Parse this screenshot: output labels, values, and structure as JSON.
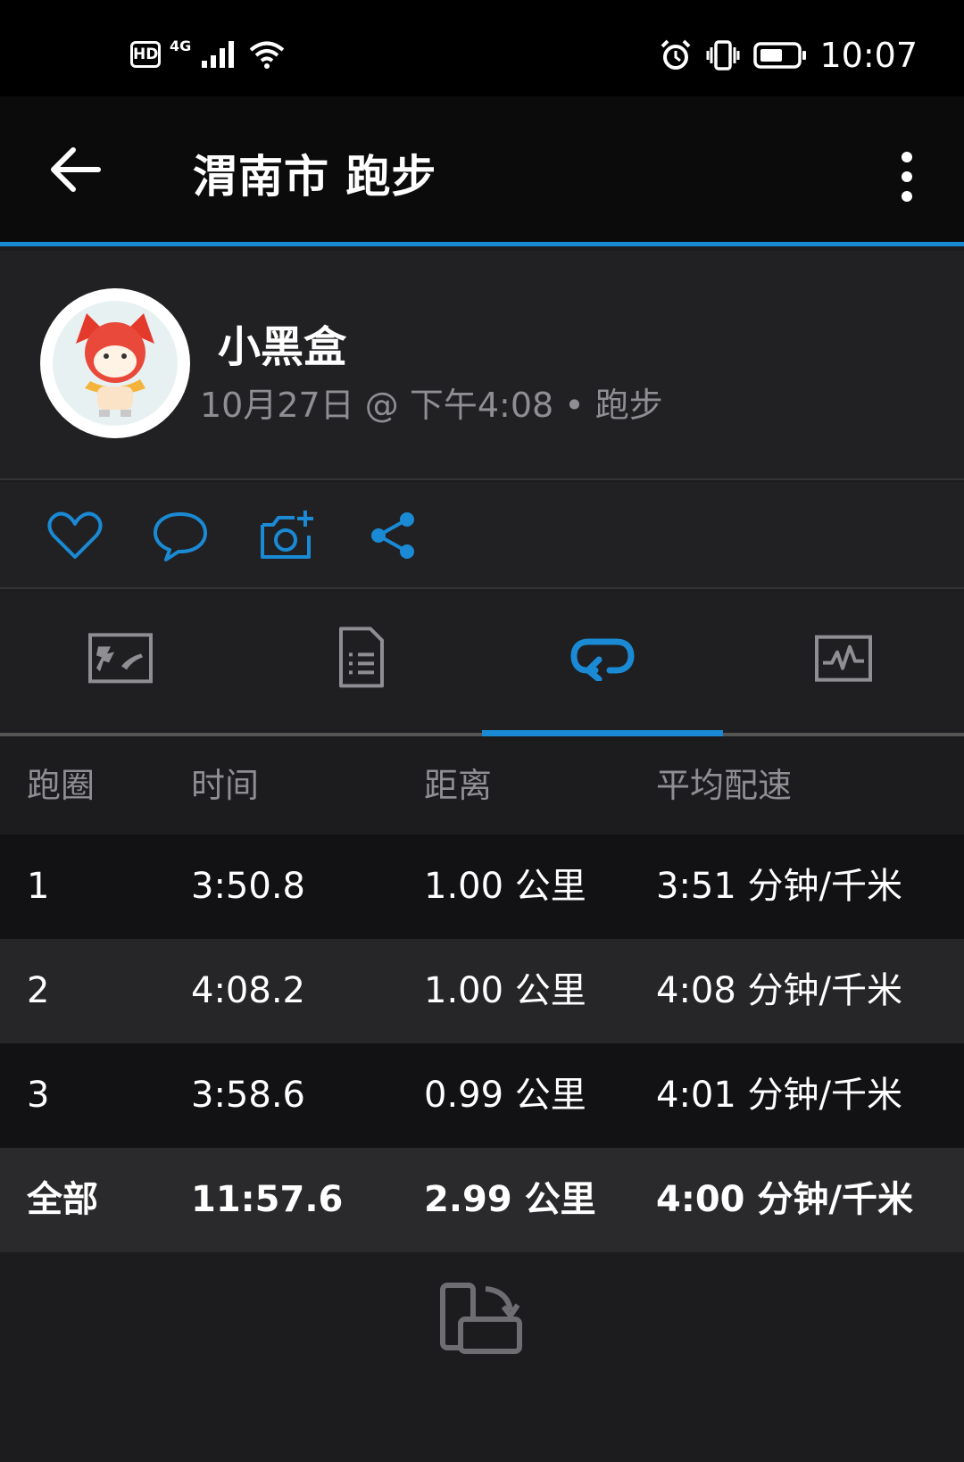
{
  "status_bar": {
    "badge": "HD",
    "network": "4G",
    "time": "10:07",
    "icons": [
      "hd-icon",
      "signal-icon",
      "wifi-icon",
      "alarm-icon",
      "vibrate-icon",
      "battery-icon"
    ]
  },
  "header": {
    "title": "渭南市 跑步",
    "back_icon": "arrow-left-icon",
    "menu_icon": "more-vertical-icon"
  },
  "profile": {
    "name": "小黑盒",
    "meta": "10月27日 @ 下午4:08 • 跑步"
  },
  "actions": [
    {
      "icon": "heart-icon"
    },
    {
      "icon": "comment-icon"
    },
    {
      "icon": "add-photo-icon"
    },
    {
      "icon": "share-icon"
    }
  ],
  "tabs": [
    {
      "icon": "map-icon",
      "active": false
    },
    {
      "icon": "summary-icon",
      "active": false
    },
    {
      "icon": "laps-icon",
      "active": true
    },
    {
      "icon": "chart-icon",
      "active": false
    }
  ],
  "laps_table": {
    "headers": [
      "跑圈",
      "时间",
      "距离",
      "平均配速"
    ],
    "rows": [
      [
        "1",
        "3:50.8",
        "1.00 公里",
        "3:51 分钟/千米"
      ],
      [
        "2",
        "4:08.2",
        "1.00 公里",
        "4:08 分钟/千米"
      ],
      [
        "3",
        "3:58.6",
        "0.99 公里",
        "4:01 分钟/千米"
      ]
    ],
    "total": [
      "全部",
      "11:57.6",
      "2.99 公里",
      "4:00 分钟/千米"
    ]
  },
  "colors": {
    "accent": "#1a8ad4",
    "background": "#1c1c1e",
    "muted_text": "#8e8e93"
  }
}
